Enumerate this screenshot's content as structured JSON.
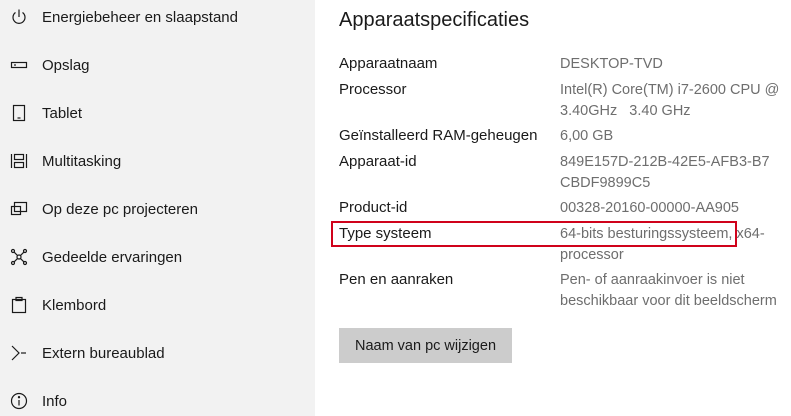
{
  "sidebar": {
    "items": [
      {
        "label": "Energiebeheer en slaapstand",
        "icon": "power-icon"
      },
      {
        "label": "Opslag",
        "icon": "storage-icon"
      },
      {
        "label": "Tablet",
        "icon": "tablet-icon"
      },
      {
        "label": "Multitasking",
        "icon": "multitasking-icon"
      },
      {
        "label": "Op deze pc projecteren",
        "icon": "project-icon"
      },
      {
        "label": "Gedeelde ervaringen",
        "icon": "shared-experiences-icon"
      },
      {
        "label": "Klembord",
        "icon": "clipboard-icon"
      },
      {
        "label": "Extern bureaublad",
        "icon": "remote-desktop-icon"
      },
      {
        "label": "Info",
        "icon": "info-icon"
      }
    ]
  },
  "main": {
    "title": "Apparaatspecificaties",
    "specs": [
      {
        "label": "Apparaatnaam",
        "value": "DESKTOP-TVD"
      },
      {
        "label": "Processor",
        "value": "Intel(R) Core(TM) i7-2600 CPU @ 3.40GHz   3.40 GHz"
      },
      {
        "label": "Geïnstalleerd RAM-geheugen",
        "value": "6,00 GB"
      },
      {
        "label": "Apparaat-id",
        "value": "849E157D-212B-42E5-AFB3-B7CBDF9899C5"
      },
      {
        "label": "Product-id",
        "value": "00328-20160-00000-AA905"
      },
      {
        "label": "Type systeem",
        "value": "64-bits besturingssysteem, x64-processor"
      },
      {
        "label": "Pen en aanraken",
        "value": "Pen- of aanraakinvoer is niet beschikbaar voor dit beeldscherm"
      }
    ],
    "rename_button": "Naam van pc wijzigen"
  },
  "colors": {
    "sidebar_bg": "#f2f2f2",
    "highlight": "#d0021b",
    "value_text": "#6e6e6e",
    "button_bg": "#cccccc"
  }
}
